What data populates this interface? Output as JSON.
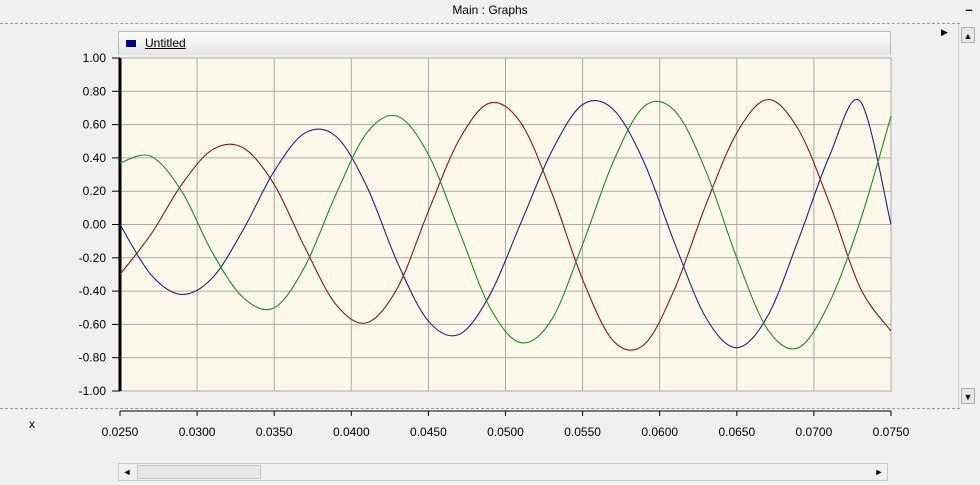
{
  "window": {
    "title": "Main : Graphs",
    "minimize_symbol": "–"
  },
  "legend": {
    "label": "Untitled",
    "color": "#000080"
  },
  "xaxis_label": "x",
  "scroll": {
    "up_arrow": "▲",
    "down_arrow": "▼",
    "left_arrow": "◄",
    "right_arrow": "►",
    "pan_right": "▶"
  },
  "colors": {
    "plot_background": "#fdf9ea",
    "grid": "#a9a9a9",
    "blue": "#1f1f90",
    "red": "#8b1414",
    "green": "#1f8b1f"
  },
  "chart_data": {
    "type": "line",
    "title": "",
    "xlabel": "x",
    "ylabel": "",
    "xlim": [
      0.025,
      0.075
    ],
    "ylim": [
      -1.0,
      1.0
    ],
    "grid": true,
    "xticks": [
      "0.0250",
      "0.0300",
      "0.0350",
      "0.0400",
      "0.0450",
      "0.0500",
      "0.0550",
      "0.0600",
      "0.0650",
      "0.0700",
      "0.0750"
    ],
    "yticks": [
      "1.00",
      "0.80",
      "0.60",
      "0.40",
      "0.20",
      "0.00",
      "-0.20",
      "-0.40",
      "-0.60",
      "-0.80",
      "-1.00"
    ],
    "series": [
      {
        "color": "#1f1f90",
        "x": [
          0.025,
          0.027,
          0.029,
          0.031,
          0.033,
          0.035,
          0.037,
          0.039,
          0.041,
          0.043,
          0.045,
          0.047,
          0.049,
          0.051,
          0.053,
          0.055,
          0.057,
          0.059,
          0.061,
          0.063,
          0.065,
          0.067,
          0.069,
          0.071,
          0.073,
          0.075
        ],
        "y": [
          0.0,
          -0.3,
          -0.42,
          -0.32,
          -0.03,
          0.32,
          0.55,
          0.53,
          0.23,
          -0.23,
          -0.58,
          -0.66,
          -0.42,
          0.01,
          0.44,
          0.72,
          0.69,
          0.37,
          -0.12,
          -0.56,
          -0.74,
          -0.55,
          -0.09,
          0.41,
          0.74,
          0.0
        ]
      },
      {
        "color": "#8b1414",
        "x": [
          0.025,
          0.027,
          0.029,
          0.031,
          0.033,
          0.035,
          0.037,
          0.039,
          0.041,
          0.043,
          0.045,
          0.047,
          0.049,
          0.051,
          0.053,
          0.055,
          0.057,
          0.059,
          0.061,
          0.063,
          0.065,
          0.067,
          0.069,
          0.071,
          0.073,
          0.075
        ],
        "y": [
          -0.3,
          -0.06,
          0.24,
          0.45,
          0.46,
          0.24,
          -0.14,
          -0.48,
          -0.59,
          -0.38,
          0.08,
          0.51,
          0.73,
          0.61,
          0.19,
          -0.33,
          -0.7,
          -0.72,
          -0.38,
          0.12,
          0.55,
          0.75,
          0.57,
          0.13,
          -0.38,
          -0.64
        ]
      },
      {
        "color": "#1f8b1f",
        "x": [
          0.025,
          0.027,
          0.029,
          0.031,
          0.033,
          0.035,
          0.037,
          0.039,
          0.041,
          0.043,
          0.045,
          0.047,
          0.049,
          0.051,
          0.053,
          0.055,
          0.057,
          0.059,
          0.061,
          0.063,
          0.065,
          0.067,
          0.069,
          0.071,
          0.073,
          0.075
        ],
        "y": [
          0.37,
          0.41,
          0.2,
          -0.17,
          -0.44,
          -0.5,
          -0.25,
          0.18,
          0.55,
          0.65,
          0.42,
          -0.04,
          -0.5,
          -0.71,
          -0.57,
          -0.12,
          0.38,
          0.71,
          0.68,
          0.32,
          -0.2,
          -0.63,
          -0.74,
          -0.47,
          0.02,
          0.65
        ]
      }
    ]
  }
}
